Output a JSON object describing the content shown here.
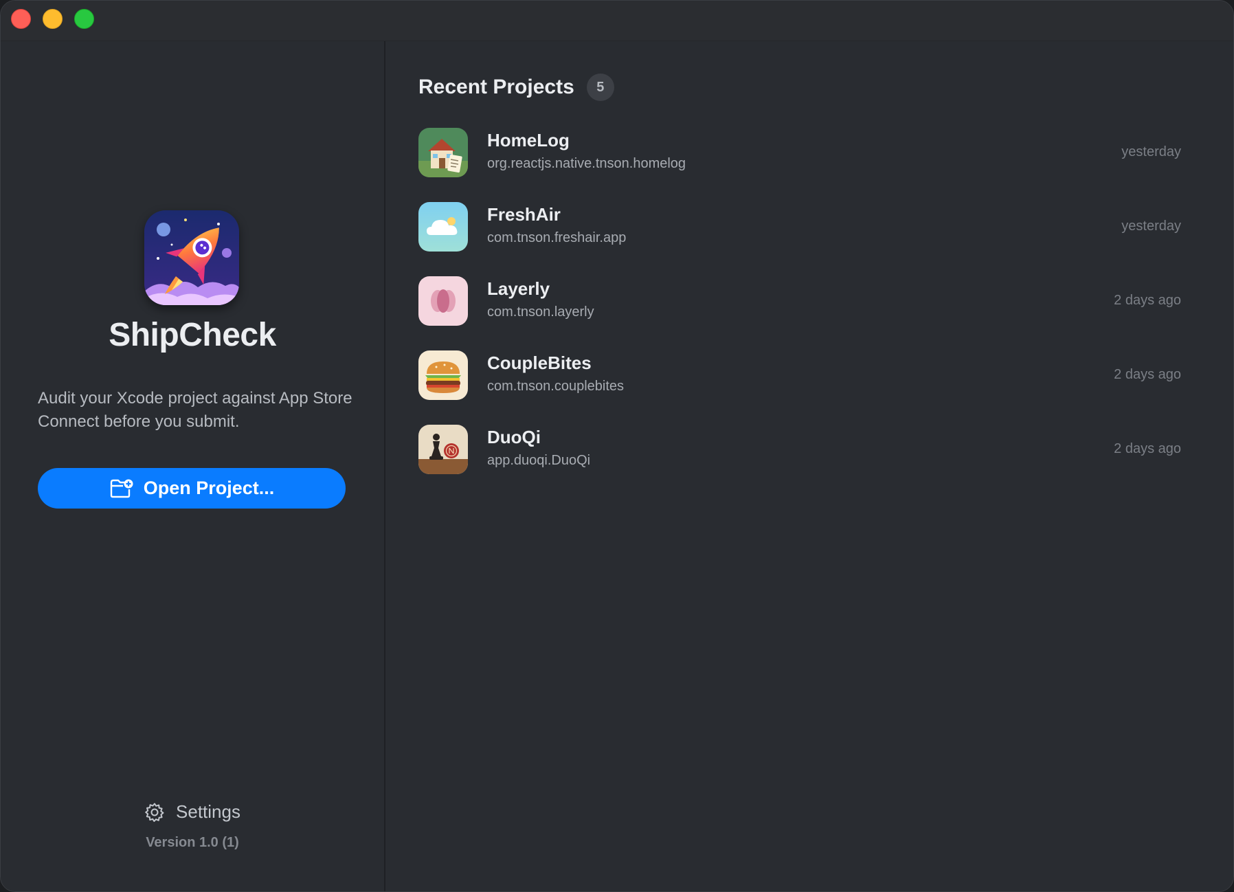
{
  "window": {
    "controls": [
      "close",
      "minimize",
      "zoom"
    ]
  },
  "sidebar": {
    "app_name": "ShipCheck",
    "tagline": "Audit your Xcode project against App Store Connect before you submit.",
    "open_button_label": "Open Project...",
    "open_button_icon": "folder-plus-icon",
    "settings_label": "Settings",
    "settings_icon": "gear-icon",
    "version": "Version 1.0 (1)"
  },
  "main": {
    "title": "Recent Projects",
    "count": "5",
    "projects": [
      {
        "name": "HomeLog",
        "bundle": "org.reactjs.native.tnson.homelog",
        "date": "yesterday",
        "icon": "house-icon"
      },
      {
        "name": "FreshAir",
        "bundle": "com.tnson.freshair.app",
        "date": "yesterday",
        "icon": "cloud-icon"
      },
      {
        "name": "Layerly",
        "bundle": "com.tnson.layerly",
        "date": "2 days ago",
        "icon": "flower-icon"
      },
      {
        "name": "CoupleBites",
        "bundle": "com.tnson.couplebites",
        "date": "2 days ago",
        "icon": "burger-icon"
      },
      {
        "name": "DuoQi",
        "bundle": "app.duoqi.DuoQi",
        "date": "2 days ago",
        "icon": "chess-icon"
      }
    ]
  },
  "colors": {
    "accent": "#0a7cff",
    "background": "#292c31",
    "title_bar": "#2b2d31",
    "close": "#fe5f57",
    "minimize": "#febc2e",
    "zoom": "#28c840"
  }
}
